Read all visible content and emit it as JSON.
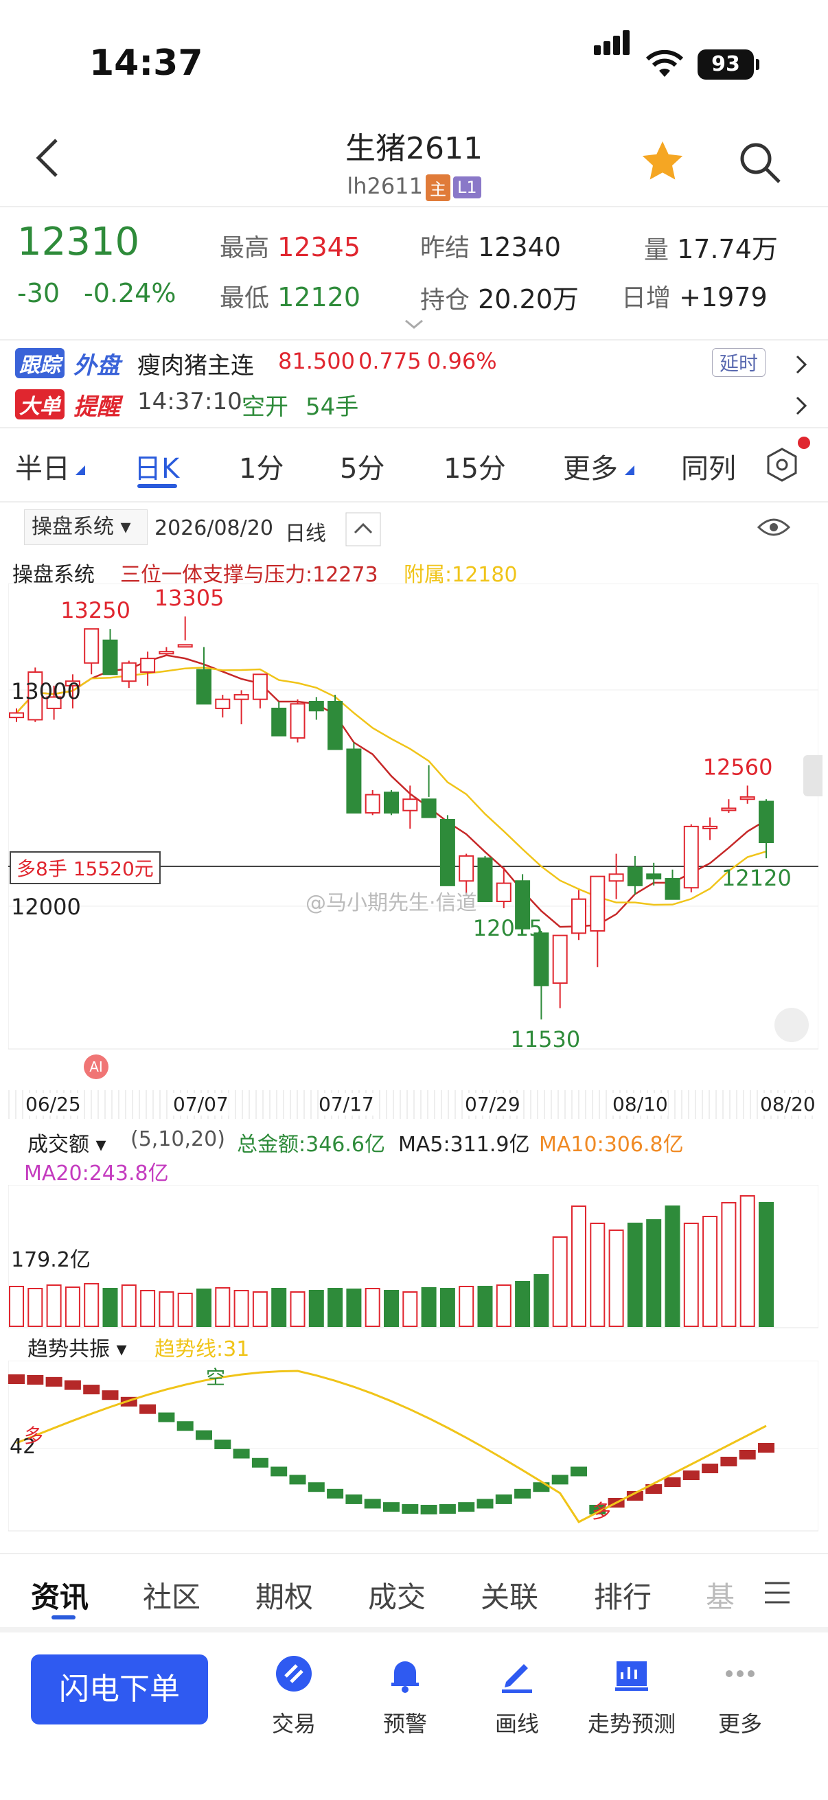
{
  "status": {
    "time": "14:37",
    "battery": "93"
  },
  "header": {
    "title": "生猪2611",
    "code": "lh2611",
    "tag_main": "主",
    "tag_l1": "L1"
  },
  "quote": {
    "last": "12310",
    "change": "-30",
    "change_pct": "-0.24%",
    "high_label": "最高",
    "high": "12345",
    "low_label": "最低",
    "low": "12120",
    "prev_label": "昨结",
    "prev": "12340",
    "oi_label": "持仓",
    "oi": "20.20万",
    "vol_label": "量",
    "vol": "17.74万",
    "day_inc_label": "日增",
    "day_inc": "+1979"
  },
  "follow": {
    "badge1": "跟踪",
    "badge2": "外盘",
    "name": "瘦肉猪主连",
    "price": "81.500",
    "chg": "0.775",
    "pct": "0.96%",
    "delay": "延时"
  },
  "alert": {
    "badge1": "大单",
    "badge2": "提醒",
    "time": "14:37:10",
    "type": "空开",
    "qty": "54手"
  },
  "period_tabs": [
    "半日",
    "日K",
    "1分",
    "5分",
    "15分",
    "更多",
    "同列"
  ],
  "chart_toolbar": {
    "system": "操盘系统",
    "date": "2026/08/20",
    "period": "日线"
  },
  "indicator_line": {
    "name": "操盘系统",
    "support": "三位一体支撑与压力:12273",
    "attach": "附属:12180"
  },
  "position_label": "多8手 15520元",
  "price_labels": {
    "p13000": "13000",
    "p12000": "12000"
  },
  "watermark": "@马小期先生·信道",
  "ai_badge": "AI",
  "dates": [
    "06/25",
    "07/07",
    "07/17",
    "07/29",
    "08/10",
    "08/20"
  ],
  "volume_header": {
    "name": "成交额",
    "params": "(5,10,20)",
    "total": "总金额:346.6亿",
    "ma5": "MA5:311.9亿",
    "ma10": "MA10:306.8亿",
    "ma20": "MA20:243.8亿",
    "axis": "179.2亿"
  },
  "trend_header": {
    "name": "趋势共振",
    "line": "趋势线:31",
    "axis": "42",
    "mark_duo": "多",
    "mark_kong": "空",
    "mark_duo2": "多"
  },
  "bottom_tabs": [
    "资讯",
    "社区",
    "期权",
    "成交",
    "关联",
    "排行",
    "基"
  ],
  "actions": {
    "flash": "闪电下单",
    "items": [
      "交易",
      "预警",
      "画线",
      "走势预测",
      "更多"
    ]
  },
  "colors": {
    "up": "#e0262f",
    "down": "#2e8b3a",
    "accent": "#2a5bdc",
    "ma_yellow": "#f0c419",
    "ma_red": "#c62828"
  },
  "chart_data": {
    "type": "candlestick",
    "x": [
      "06/25",
      "06/26",
      "06/29",
      "06/30",
      "07/01",
      "07/02",
      "07/03",
      "07/06",
      "07/07",
      "07/08",
      "07/09",
      "07/10",
      "07/13",
      "07/14",
      "07/15",
      "07/16",
      "07/17",
      "07/20",
      "07/21",
      "07/22",
      "07/23",
      "07/24",
      "07/27",
      "07/28",
      "07/29",
      "07/30",
      "07/31",
      "08/03",
      "08/04",
      "08/05",
      "08/06",
      "08/07",
      "08/10",
      "08/11",
      "08/12",
      "08/13",
      "08/14",
      "08/17",
      "08/18",
      "08/19",
      "08/20"
    ],
    "ohlc": [
      [
        12860,
        12900,
        12840,
        12880
      ],
      [
        12850,
        13080,
        12840,
        13060
      ],
      [
        12900,
        13000,
        12850,
        12950
      ],
      [
        13000,
        13050,
        12900,
        13020
      ],
      [
        13100,
        13250,
        13050,
        13250
      ],
      [
        13200,
        13250,
        13080,
        13050
      ],
      [
        13020,
        13110,
        12990,
        13100
      ],
      [
        13060,
        13150,
        13000,
        13120
      ],
      [
        13150,
        13170,
        13130,
        13150
      ],
      [
        13180,
        13305,
        13200,
        13180
      ],
      [
        13070,
        13170,
        12940,
        12920
      ],
      [
        12900,
        12960,
        12860,
        12940
      ],
      [
        12940,
        12980,
        12830,
        12960
      ],
      [
        12940,
        13000,
        12900,
        13050
      ],
      [
        12900,
        12930,
        12780,
        12780
      ],
      [
        12770,
        12940,
        12750,
        12920
      ],
      [
        12930,
        12950,
        12850,
        12890
      ],
      [
        12930,
        12960,
        12750,
        12720
      ],
      [
        12720,
        12750,
        12460,
        12440
      ],
      [
        12440,
        12540,
        12430,
        12520
      ],
      [
        12530,
        12540,
        12430,
        12440
      ],
      [
        12450,
        12560,
        12370,
        12500
      ],
      [
        12500,
        12650,
        12510,
        12420
      ],
      [
        12410,
        12430,
        12120,
        12120
      ],
      [
        12140,
        12260,
        12080,
        12250
      ],
      [
        12240,
        12250,
        12080,
        12050
      ],
      [
        12050,
        12200,
        12020,
        12130
      ],
      [
        12140,
        12170,
        11960,
        11930
      ],
      [
        11910,
        11920,
        11530,
        11680
      ],
      [
        11690,
        11900,
        11580,
        11900
      ],
      [
        11910,
        12100,
        11880,
        12060
      ],
      [
        11920,
        12120,
        11760,
        12160
      ],
      [
        12140,
        12260,
        12060,
        12170
      ],
      [
        12200,
        12250,
        12080,
        12120
      ],
      [
        12170,
        12220,
        12120,
        12150
      ],
      [
        12150,
        12190,
        12060,
        12060
      ],
      [
        12110,
        12390,
        12090,
        12380
      ],
      [
        12380,
        12420,
        12320,
        12380
      ],
      [
        12460,
        12500,
        12440,
        12460
      ],
      [
        12500,
        12560,
        12480,
        12510
      ],
      [
        12490,
        12500,
        12240,
        12310
      ]
    ],
    "annotations": [
      "13250",
      "13305",
      "12015",
      "11530",
      "12560",
      "12120"
    ],
    "ylim": [
      11400,
      13450
    ]
  }
}
